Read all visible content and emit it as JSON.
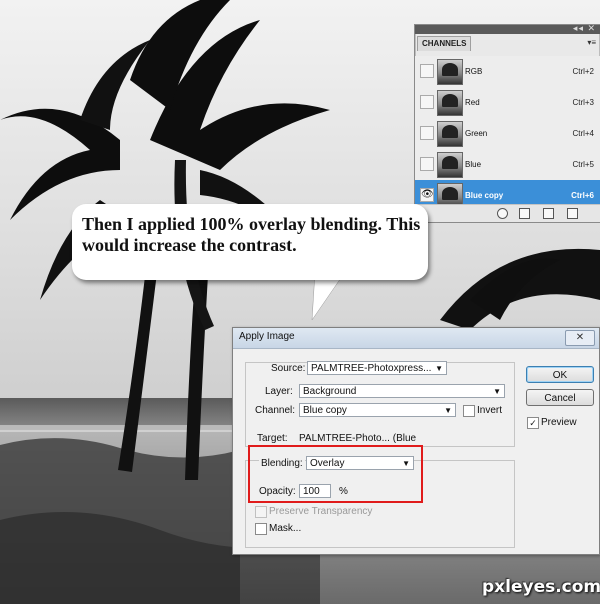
{
  "channels_panel": {
    "tab_label": "CHANNELS",
    "channels": [
      {
        "name": "RGB",
        "shortcut": "Ctrl+2",
        "selected": false,
        "visible": false
      },
      {
        "name": "Red",
        "shortcut": "Ctrl+3",
        "selected": false,
        "visible": false
      },
      {
        "name": "Green",
        "shortcut": "Ctrl+4",
        "selected": false,
        "visible": false
      },
      {
        "name": "Blue",
        "shortcut": "Ctrl+5",
        "selected": false,
        "visible": false
      },
      {
        "name": "Blue copy",
        "shortcut": "Ctrl+6",
        "selected": true,
        "visible": true
      }
    ],
    "selected_color": "#3b8fd8"
  },
  "bubble": {
    "text": "Then I applied 100% overlay blending. This would increase the contrast."
  },
  "apply_image": {
    "title": "Apply Image",
    "source_label": "Source:",
    "source_value": "PALMTREE-Photoxpress...",
    "layer_label": "Layer:",
    "layer_value": "Background",
    "channel_label": "Channel:",
    "channel_value": "Blue copy",
    "invert_label": "Invert",
    "target_label": "Target:",
    "target_value": "PALMTREE-Photo... (Blue",
    "blending_label": "Blending:",
    "blending_value": "Overlay",
    "opacity_label": "Opacity:",
    "opacity_value": "100",
    "opacity_unit": "%",
    "preserve_transparency_label": "Preserve Transparency",
    "mask_label": "Mask...",
    "ok_label": "OK",
    "cancel_label": "Cancel",
    "preview_label": "Preview",
    "preview_checked": true,
    "close_glyph": "✕"
  },
  "highlight_color": "#e01b1b",
  "watermark": "pxleyes.com"
}
